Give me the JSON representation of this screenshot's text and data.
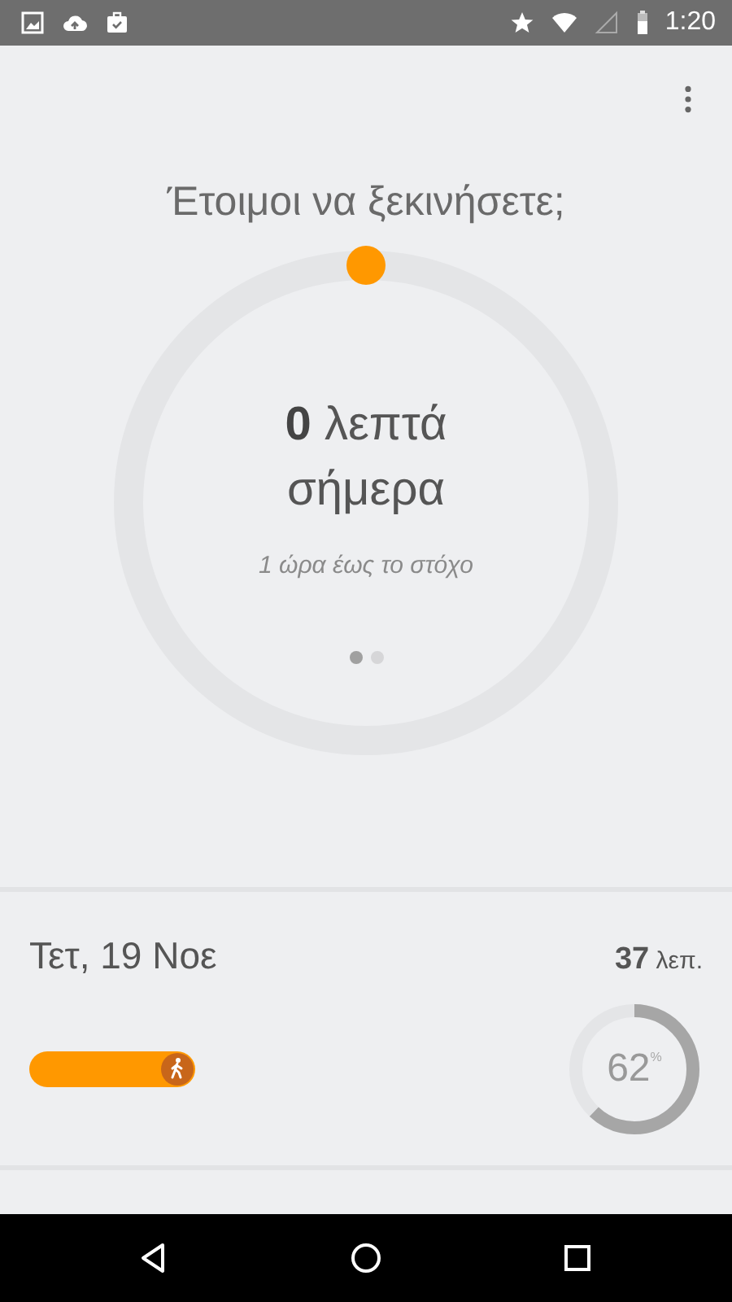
{
  "status_bar": {
    "time": "1:20"
  },
  "header": {
    "title": "Έτοιμοι να ξεκινήσετε;"
  },
  "progress_ring": {
    "summary": "**0** λεπτά σήμερα",
    "goal": "1 ώρα έως το στόχο",
    "pages": [
      {
        "selected": true
      },
      {
        "selected": false
      }
    ]
  },
  "day_card": {
    "date": "Τετ, 19 Νοε",
    "total": "**37** λεπ.",
    "percent": "62",
    "percent_sign": "%"
  }
}
